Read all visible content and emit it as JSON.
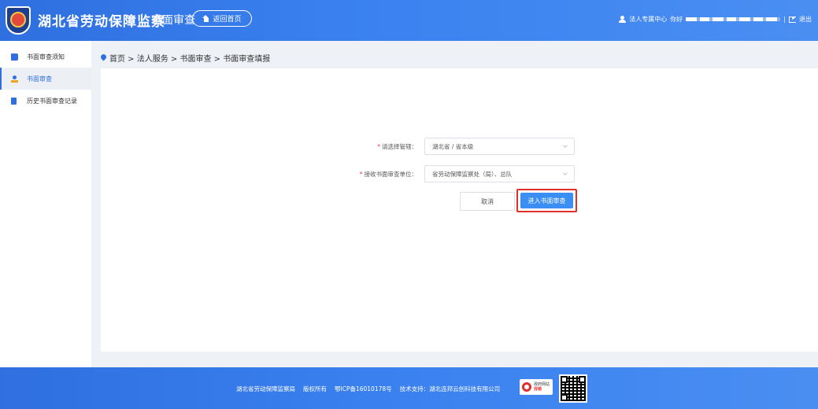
{
  "header": {
    "site_title": "湖北省劳动保障监察",
    "section_title": "书面审查",
    "home_button": "返回首页",
    "user_center": "法人专属中心",
    "greeting": "你好",
    "separator": "|",
    "logout": "退出"
  },
  "sidebar": {
    "items": [
      {
        "label": "书面审查须知",
        "icon": "book-icon"
      },
      {
        "label": "书面审查",
        "icon": "person-icon"
      },
      {
        "label": "历史书面审查记录",
        "icon": "document-icon"
      }
    ]
  },
  "breadcrumb": "首页 > 法人服务 > 书面审查 > 书面审查填报",
  "form": {
    "field1": {
      "label": "请选择管辖：",
      "value": "湖北省 / 省本级"
    },
    "field2": {
      "label": "接收书面审查单位：",
      "value": "省劳动保障监察处（局）、总队"
    },
    "required_mark": "*",
    "cancel": "取消",
    "submit": "进入书面审查"
  },
  "footer": {
    "org": "湖北省劳动保障监察局",
    "rights": "版权所有",
    "icp": "鄂ICP备16010178号",
    "tech": "技术支持：湖北连邦云创科技有限公司",
    "badge_top": "政府网站",
    "badge_bottom": "找错"
  },
  "colors": {
    "primary": "#2f6fe0",
    "highlight": "#e0302a",
    "button": "#3a8ef4"
  }
}
